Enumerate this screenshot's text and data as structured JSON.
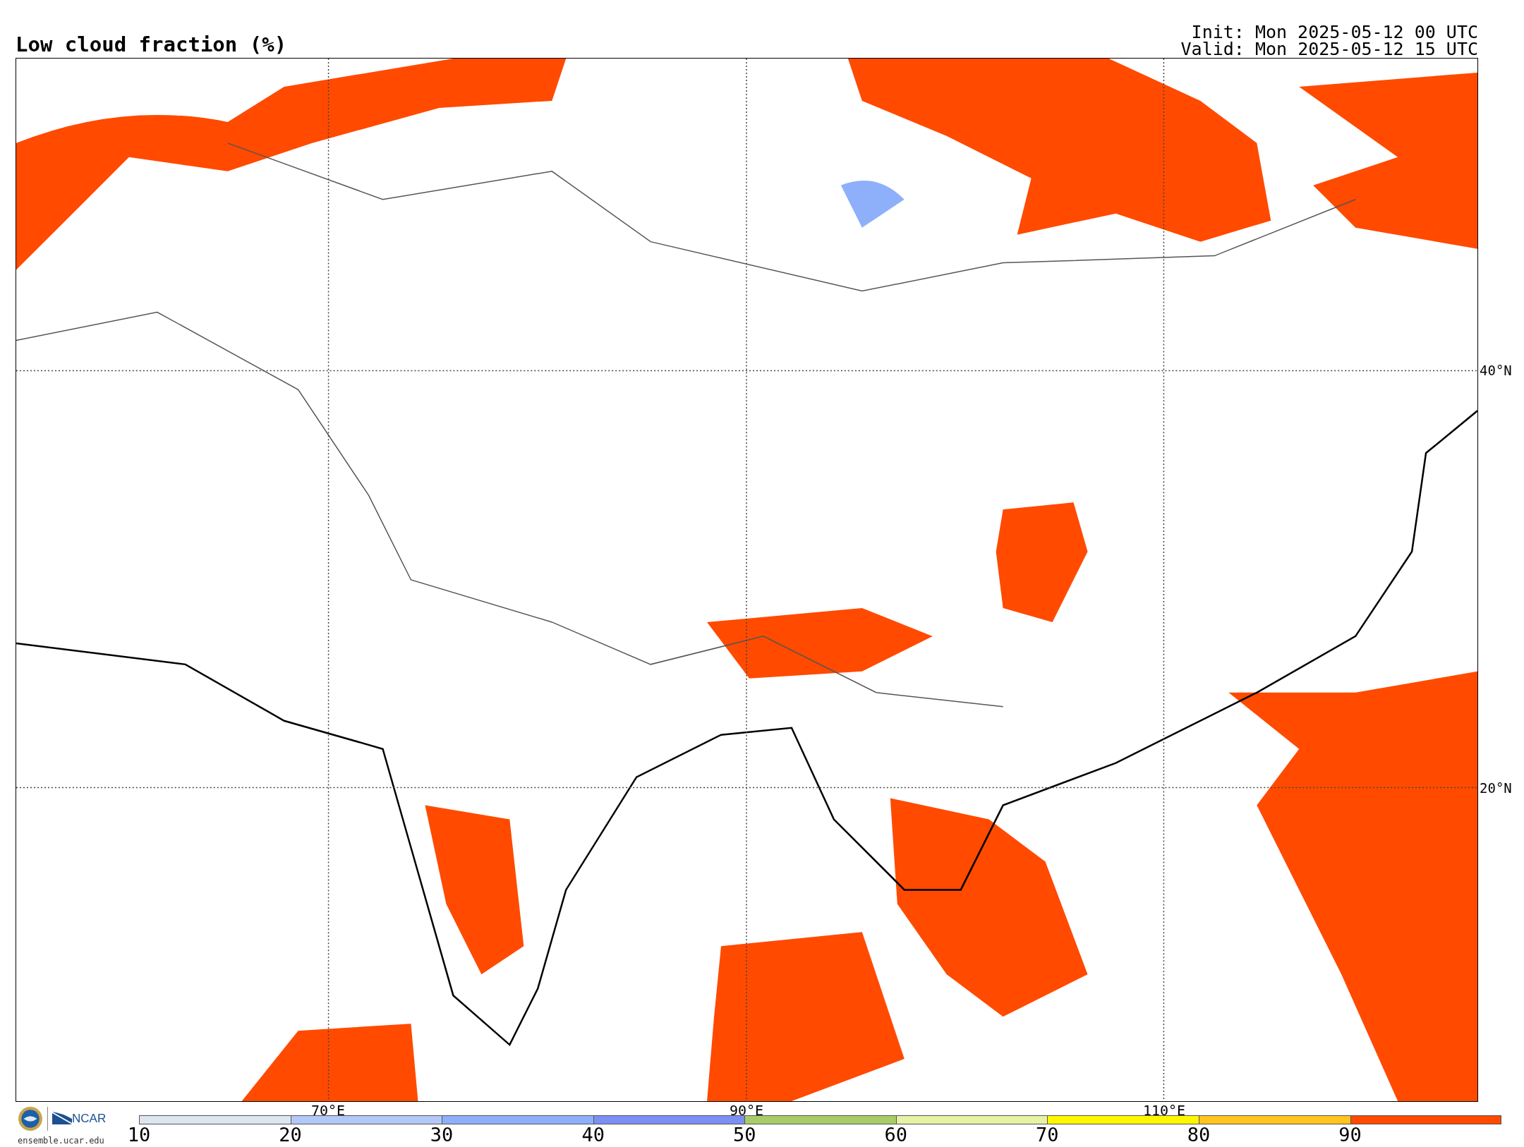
{
  "title": "Low cloud fraction (%)",
  "init": "Init: Mon 2025-05-12 00 UTC",
  "valid": "Valid: Mon 2025-05-12 15 UTC",
  "map": {
    "lat_labels": [
      "40°N",
      "20°N"
    ],
    "lon_labels": [
      "70°E",
      "90°E",
      "110°E"
    ]
  },
  "logos": {
    "ncar": "NCAR",
    "site": "ensemble.ucar.edu"
  },
  "colorbar": {
    "bins": [
      {
        "label": "10",
        "color": "#dde6ee"
      },
      {
        "label": "20",
        "color": "#b4c8f8"
      },
      {
        "label": "30",
        "color": "#8eb0fa"
      },
      {
        "label": "40",
        "color": "#7c8ff5"
      },
      {
        "label": "50",
        "color": "#a8cd68"
      },
      {
        "label": "60",
        "color": "#e6f2a4"
      },
      {
        "label": "70",
        "color": "#fff700"
      },
      {
        "label": "80",
        "color": "#ffc41f"
      },
      {
        "label": "90",
        "color": "#ff4a00"
      }
    ]
  }
}
